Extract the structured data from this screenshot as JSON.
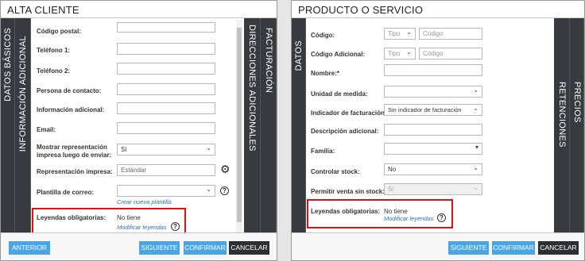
{
  "left": {
    "title": "ALTA CLIENTE",
    "tabs": {
      "datos_basicos": "DATOS BÁSICOS",
      "informacion_adicional": "INFORMACIÓN ADICIONAL",
      "direcciones_adicionales": "DIRECCIONES ADICIONALES",
      "facturacion": "FACTURACIÓN"
    },
    "fields": {
      "codigo_postal": "Código postal:",
      "telefono1": "Teléfono 1:",
      "telefono2": "Teléfono 2:",
      "persona_contacto": "Persona de contacto:",
      "informacion_adicional": "Información adicional:",
      "email": "Email:",
      "mostrar_repr": "Mostrar representación impresa luego de enviar:",
      "mostrar_repr_value": "Sí",
      "representacion": "Representación impresa:",
      "representacion_value": "Estándar",
      "plantilla": "Plantilla de correo:",
      "crear_plantilla": "Crear nueva plantilla",
      "leyendas": "Leyendas obligatorias:",
      "leyendas_value": "No tiene",
      "modificar_leyendas": "Modificar leyendas"
    },
    "buttons": {
      "anterior": "ANTERIOR",
      "siguiente": "SIGUIENTE",
      "confirmar": "CONFIRMAR",
      "cancelar": "CANCELAR"
    }
  },
  "right": {
    "title": "PRODUCTO O SERVICIO",
    "tabs": {
      "datos": "DATOS",
      "retenciones": "RETENCIONES",
      "precios": "PRECIOS"
    },
    "fields": {
      "codigo": "Código:",
      "tipo": "Tipo",
      "codigo_ph": "Código",
      "codigo_adicional": "Código Adicional:",
      "nombre": "Nombre:*",
      "unidad": "Unidad de medida:",
      "indicador": "Indicador de facturación:",
      "indicador_value": "Sin indicador de facturación",
      "descripcion": "Descripción adicional:",
      "familia": "Familia:",
      "controlar_stock": "Controlar stock:",
      "controlar_value": "No",
      "permitir": "Permitir venta sin stock:",
      "permitir_value": "Sí",
      "leyendas": "Leyendas obligatorias:",
      "leyendas_value": "No tiene",
      "modificar_leyendas": "Modificar leyendas"
    },
    "buttons": {
      "siguiente": "SIGUIENTE",
      "confirmar": "CONFIRMAR",
      "cancelar": "CANCELAR"
    }
  },
  "colors": {
    "button_blue": "#49a6e6",
    "tab_dark": "#373a3e",
    "highlight": "#e01010",
    "link": "#2a6fb3"
  }
}
